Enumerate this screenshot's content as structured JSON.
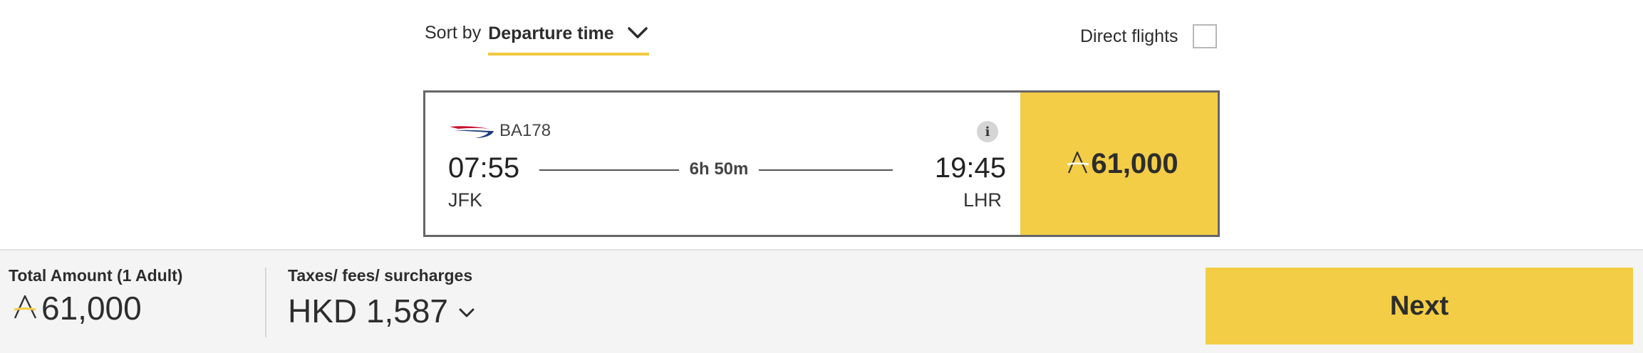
{
  "sort": {
    "label": "Sort by",
    "selected": "Departure time"
  },
  "filters": {
    "direct_label": "Direct flights",
    "direct_checked": false
  },
  "flight": {
    "airline_logo": "british-airways-speedmarque",
    "flight_number": "BA178",
    "departure_time": "07:55",
    "departure_airport": "JFK",
    "arrival_time": "19:45",
    "arrival_airport": "LHR",
    "duration": "6h 50m",
    "price": "61,000",
    "price_currency_icon": "avios-icon"
  },
  "summary": {
    "total_label": "Total Amount (1 Adult)",
    "total_value": "61,000",
    "taxes_label": "Taxes/ fees/ surcharges",
    "taxes_value": "HKD 1,587",
    "next_label": "Next"
  },
  "colors": {
    "accent_yellow": "#f3cd45",
    "card_border": "#666666",
    "bar_background": "#f4f4f4"
  }
}
